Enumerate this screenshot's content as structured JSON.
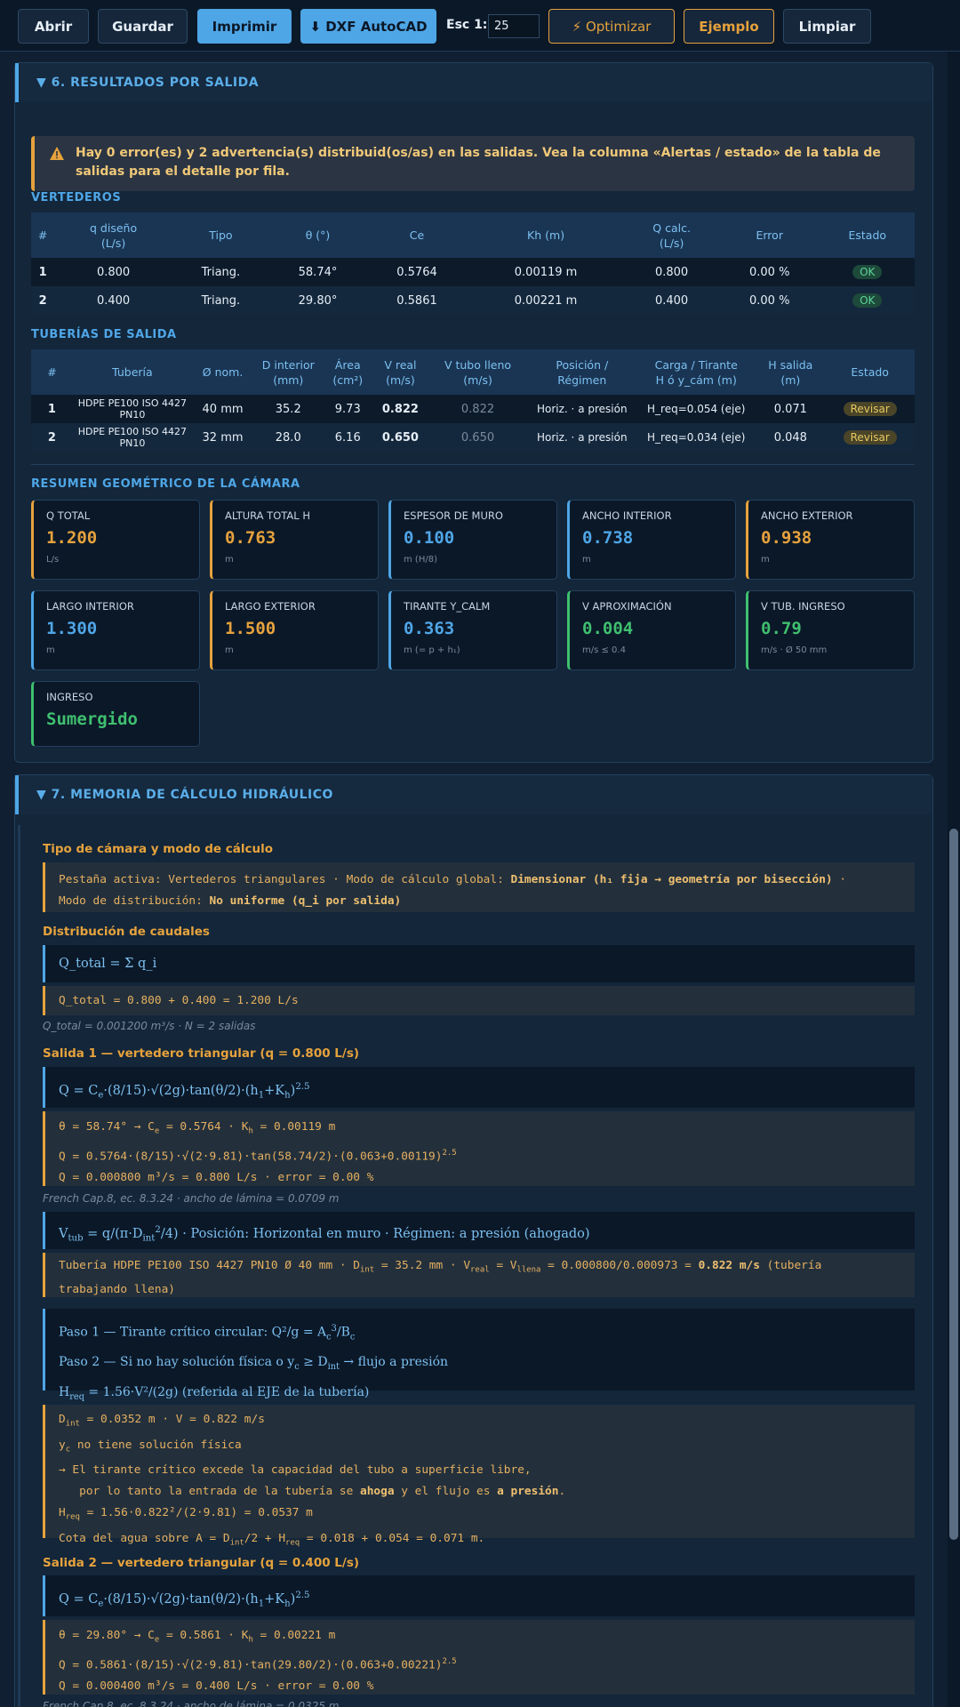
{
  "toolbar": {
    "abrir": "Abrir",
    "guardar": "Guardar",
    "imprimir": "Imprimir",
    "dxf": "⬇ DXF AutoCAD",
    "esc_label": "Esc 1:",
    "esc_value": "25",
    "optimizar": "⚡ Optimizar",
    "ejemplo": "Ejemplo",
    "limpiar": "Limpiar"
  },
  "s6": {
    "title": "▼ 6. RESULTADOS POR SALIDA",
    "alert": "Hay 0 error(es) y 2 advertencia(s) distribuid(os/as) en las salidas. Vea la columna «Alertas / estado» de la tabla de salidas para el detalle por fila.",
    "vert_title": "VERTEDEROS",
    "vert_headers": [
      "#",
      "q diseño\n(L/s)",
      "Tipo",
      "θ (°)",
      "Ce",
      "Kh (m)",
      "Q calc.\n(L/s)",
      "Error",
      "Estado"
    ],
    "vert_rows": [
      [
        "1",
        "0.800",
        "Triang.",
        "58.74°",
        "0.5764",
        "0.00119 m",
        "0.800",
        "0.00 %",
        "OK"
      ],
      [
        "2",
        "0.400",
        "Triang.",
        "29.80°",
        "0.5861",
        "0.00221 m",
        "0.400",
        "0.00 %",
        "OK"
      ]
    ],
    "tub_title": "TUBERÍAS DE SALIDA",
    "tub_headers": [
      "#",
      "Tubería",
      "Ø nom.",
      "D interior\n(mm)",
      "Área\n(cm²)",
      "V real\n(m/s)",
      "V tubo lleno\n(m/s)",
      "Posición /\nRégimen",
      "Carga / Tirante\nH ó y_cám (m)",
      "H salida\n(m)",
      "Estado"
    ],
    "tub_rows": [
      [
        "1",
        "HDPE PE100 ISO 4427 PN10",
        "40 mm",
        "35.2",
        "9.73",
        "0.822",
        "0.822",
        "Horiz. · a presión",
        "H_req=0.054 (eje)",
        "0.071",
        "Revisar"
      ],
      [
        "2",
        "HDPE PE100 ISO 4427 PN10",
        "32 mm",
        "28.0",
        "6.16",
        "0.650",
        "0.650",
        "Horiz. · a presión",
        "H_req=0.034 (eje)",
        "0.048",
        "Revisar"
      ]
    ],
    "geo_title": "RESUMEN GEOMÉTRICO DE LA CÁMARA",
    "cards": [
      {
        "label": "Q TOTAL",
        "value": "1.200",
        "unit": "L/s"
      },
      {
        "label": "ALTURA TOTAL H",
        "value": "0.763",
        "unit": "m"
      },
      {
        "label": "ESPESOR DE MURO",
        "value": "0.100",
        "unit": "m (H/8)"
      },
      {
        "label": "ANCHO INTERIOR",
        "value": "0.738",
        "unit": "m"
      },
      {
        "label": "ANCHO EXTERIOR",
        "value": "0.938",
        "unit": "m"
      },
      {
        "label": "LARGO INTERIOR",
        "value": "1.300",
        "unit": "m"
      },
      {
        "label": "LARGO EXTERIOR",
        "value": "1.500",
        "unit": "m"
      },
      {
        "label": "TIRANTE Y_CALM",
        "value": "0.363",
        "unit": "m (= p + h₁)"
      },
      {
        "label": "V APROXIMACIÓN",
        "value": "0.004",
        "unit": "m/s ≤ 0.4"
      },
      {
        "label": "V TUB. INGRESO",
        "value": "0.79",
        "unit": "m/s · Ø 50 mm"
      },
      {
        "label": "INGRESO",
        "value": "Sumergido",
        "unit": ""
      }
    ]
  },
  "s7": {
    "title": "▼ 7. MEMORIA DE CÁLCULO HIDRÁULICO",
    "t1": "Tipo de cámara y modo de cálculo",
    "t1_a": "Pestaña activa: Vertederos triangulares · Modo de cálculo global: ",
    "t1_b": "Dimensionar (h₁ fija → geometría por bisección)",
    "t1_c": " ·",
    "t1_d": "Modo de distribución: ",
    "t1_e": "No uniforme (q_i por salida)",
    "t2": "Distribución de caudales",
    "f_qtotal": "Q_total = Σ q_i",
    "c_qtotal": "Q_total = 0.800 + 0.400 = 1.200 L/s",
    "n_qtotal": "Q_total = 0.001200 m³/s · N = 2 salidas",
    "t3": "Salida 1 — vertedero triangular (q = 0.800 L/s)",
    "s1_c1a": "θ = 58.74° → C",
    "s1_c1b": " = 0.5764  · K",
    "s1_c1c": " = 0.00119 m",
    "s1_c2": "Q = 0.5764·(8/15)·√(2·9.81)·tan(58.74/2)·(0.063+0.00119)",
    "s1_c3": "Q = 0.000800 m³/s = 0.800 L/s  · error = 0.00 %",
    "s1_note": "French Cap.8, ec. 8.3.24 · ancho de lámina = 0.0709 m",
    "s1_f2": " · Posición: Horizontal en muro · Régimen: a presión (ahogado)",
    "s1_c4a": "Tubería HDPE PE100 ISO 4427 PN10 Ø 40 mm  · D",
    "s1_c4b": " = 35.2 mm  · V",
    "s1_c4c": " = V",
    "s1_c4d": " = 0.000800/0.000973 = ",
    "s1_c4e": "0.822 m/s",
    "s1_c4f": " (tubería",
    "s1_c4g": "trabajando llena)",
    "p1": "Paso 1 — Tirante crítico circular: Q²/g = A",
    "p2a": "Paso 2 — Si no hay solución física o y",
    "p2b": " ≥ D",
    "p2c": " → flujo a presión",
    "p3": " = 1.56·V²/(2g) (referida al EJE de la tubería)",
    "d1": " = 0.0352 m  · V = 0.822 m/s",
    "d2": " no tiene solución física",
    "d3": "→ El tirante crítico excede la capacidad del tubo a superficie libre,",
    "d4a": "   por lo tanto la entrada de la tubería se ",
    "d4b": "ahoga",
    "d4c": " y el flujo es ",
    "d4d": "a presión",
    "d4e": ".",
    "d5": " = 1.56·0.822²/(2·9.81) = 0.0537 m",
    "d6a": "Cota del agua sobre A = D",
    "d6b": "/2 + H",
    "d6c": " = 0.018 + 0.054 = 0.071 m.",
    "t4": "Salida 2 — vertedero triangular (q = 0.400 L/s)",
    "s2_c1a": "θ = 29.80° → C",
    "s2_c1b": " = 0.5861  · K",
    "s2_c1c": " = 0.00221 m",
    "s2_c2": "Q = 0.5861·(8/15)·√(2·9.81)·tan(29.80/2)·(0.063+0.00221)",
    "s2_c3": "Q = 0.000400 m³/s = 0.400 L/s  · error = 0.00 %",
    "s2_note": "French Cap.8, ec. 8.3.24 · ancho de lámina = 0.0325 m"
  },
  "colors": {
    "accent": "#4fa6e6",
    "warn": "#e6a23c",
    "ok": "#3fbf6f",
    "bg": "#102032"
  }
}
